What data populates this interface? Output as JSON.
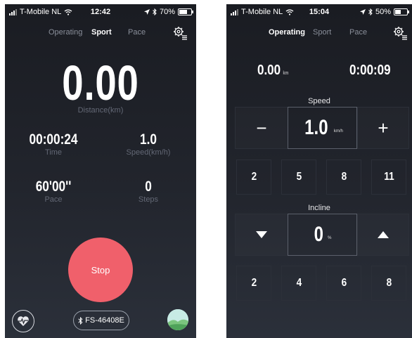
{
  "left": {
    "status": {
      "carrier": "T-Mobile NL",
      "time": "12:42",
      "battery": "70%",
      "battery_level": 0.7
    },
    "tabs": [
      {
        "label": "Operating",
        "active": false
      },
      {
        "label": "Sport",
        "active": true
      },
      {
        "label": "Pace",
        "active": false
      }
    ],
    "distance": {
      "value": "0.00",
      "label": "Distance(km)"
    },
    "time": {
      "value": "00:00:24",
      "label": "Time"
    },
    "speed": {
      "value": "1.0",
      "label": "Speed(km/h)"
    },
    "pace": {
      "value": "60'00''",
      "label": "Pace"
    },
    "steps": {
      "value": "0",
      "label": "Steps"
    },
    "stop_label": "Stop",
    "device_name": "FS-46408E",
    "colors": {
      "accent": "#f0606b",
      "avatar": "#bfe4e2"
    }
  },
  "right": {
    "status": {
      "carrier": "T-Mobile NL",
      "time": "15:04",
      "battery": "50%",
      "battery_level": 0.5
    },
    "tabs": [
      {
        "label": "Operating",
        "active": true
      },
      {
        "label": "Sport",
        "active": false
      },
      {
        "label": "Pace",
        "active": false
      }
    ],
    "distance": {
      "value": "0.00",
      "unit": "km"
    },
    "elapsed": "0:00:09",
    "speed": {
      "label": "Speed",
      "value": "1.0",
      "unit": "km/h",
      "minus": "−",
      "plus": "+",
      "presets": [
        "2",
        "5",
        "8",
        "11"
      ]
    },
    "incline": {
      "label": "Incline",
      "value": "0",
      "unit": "%",
      "presets": [
        "2",
        "4",
        "6",
        "8"
      ]
    }
  }
}
